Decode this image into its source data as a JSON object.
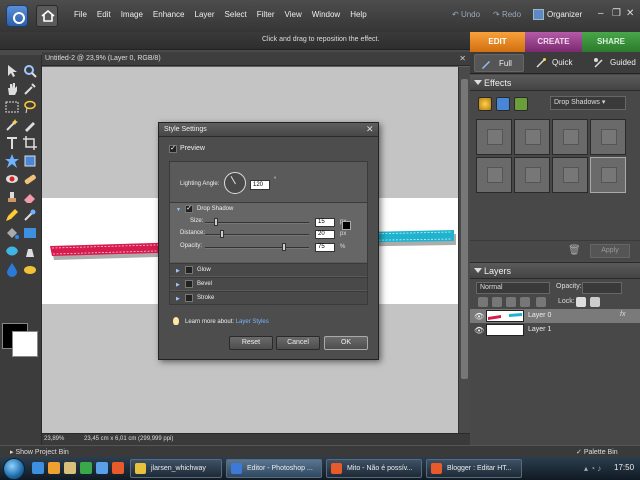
{
  "menubar": {
    "items": [
      "File",
      "Edit",
      "Image",
      "Enhance",
      "Layer",
      "Select",
      "Filter",
      "View",
      "Window",
      "Help"
    ],
    "undo": "Undo",
    "redo": "Redo",
    "organizer": "Organizer"
  },
  "options_bar": {
    "hint": "Click and drag to reposition the effect."
  },
  "mode_tabs": {
    "edit": "EDIT",
    "create": "CREATE",
    "share": "SHARE"
  },
  "sub_tabs": {
    "full": "Full",
    "quick": "Quick",
    "guided": "Guided"
  },
  "document": {
    "title": "Untitled-2 @ 23,9% (Layer 0, RGB/8)",
    "zoom": "23,89%",
    "info": "23,45 cm x 6,01 cm (299,999 ppi)"
  },
  "effects_panel": {
    "title": "Effects",
    "category": "Drop Shadows",
    "apply_label": "Apply"
  },
  "layers_panel": {
    "title": "Layers",
    "blend_mode": "Normal",
    "opacity_label": "Opacity:",
    "lock_label": "Lock:",
    "layers": [
      {
        "name": "Layer 0",
        "selected": true
      },
      {
        "name": "Layer 1",
        "selected": false
      }
    ]
  },
  "bottom_bar": {
    "show_bin": "Show Project Bin",
    "palette_bin": "Palette Bin"
  },
  "dialog": {
    "title": "Style Settings",
    "preview_label": "Preview",
    "lighting_angle_label": "Lighting Angle:",
    "lighting_angle_value": "120",
    "degree_symbol": "°",
    "drop_shadow_label": "Drop Shadow",
    "size_label": "Size:",
    "size_value": "15",
    "size_unit": "px",
    "distance_label": "Distance:",
    "distance_value": "20",
    "distance_unit": "px",
    "opacity_label": "Opacity:",
    "opacity_value": "75",
    "opacity_unit": "%",
    "sections": [
      "Glow",
      "Bevel",
      "Stroke"
    ],
    "learn_text": "Learn more about:",
    "learn_link": "Layer Styles",
    "reset": "Reset",
    "cancel": "Cancel",
    "ok": "OK"
  },
  "taskbar": {
    "tasks": [
      "jlarsen_whichway",
      "Editor - Photoshop ...",
      "Mito - Não é possív...",
      "Blogger : Editar HT..."
    ],
    "clock": "17:50"
  },
  "colors": {
    "accent_edit": "#e88b21",
    "accent_create": "#9b3d8e",
    "accent_share": "#3b8f3c",
    "ribbon_pink": "#d81b4f",
    "ribbon_cyan": "#1fb3cf",
    "arrow_red": "#cc1a10"
  }
}
